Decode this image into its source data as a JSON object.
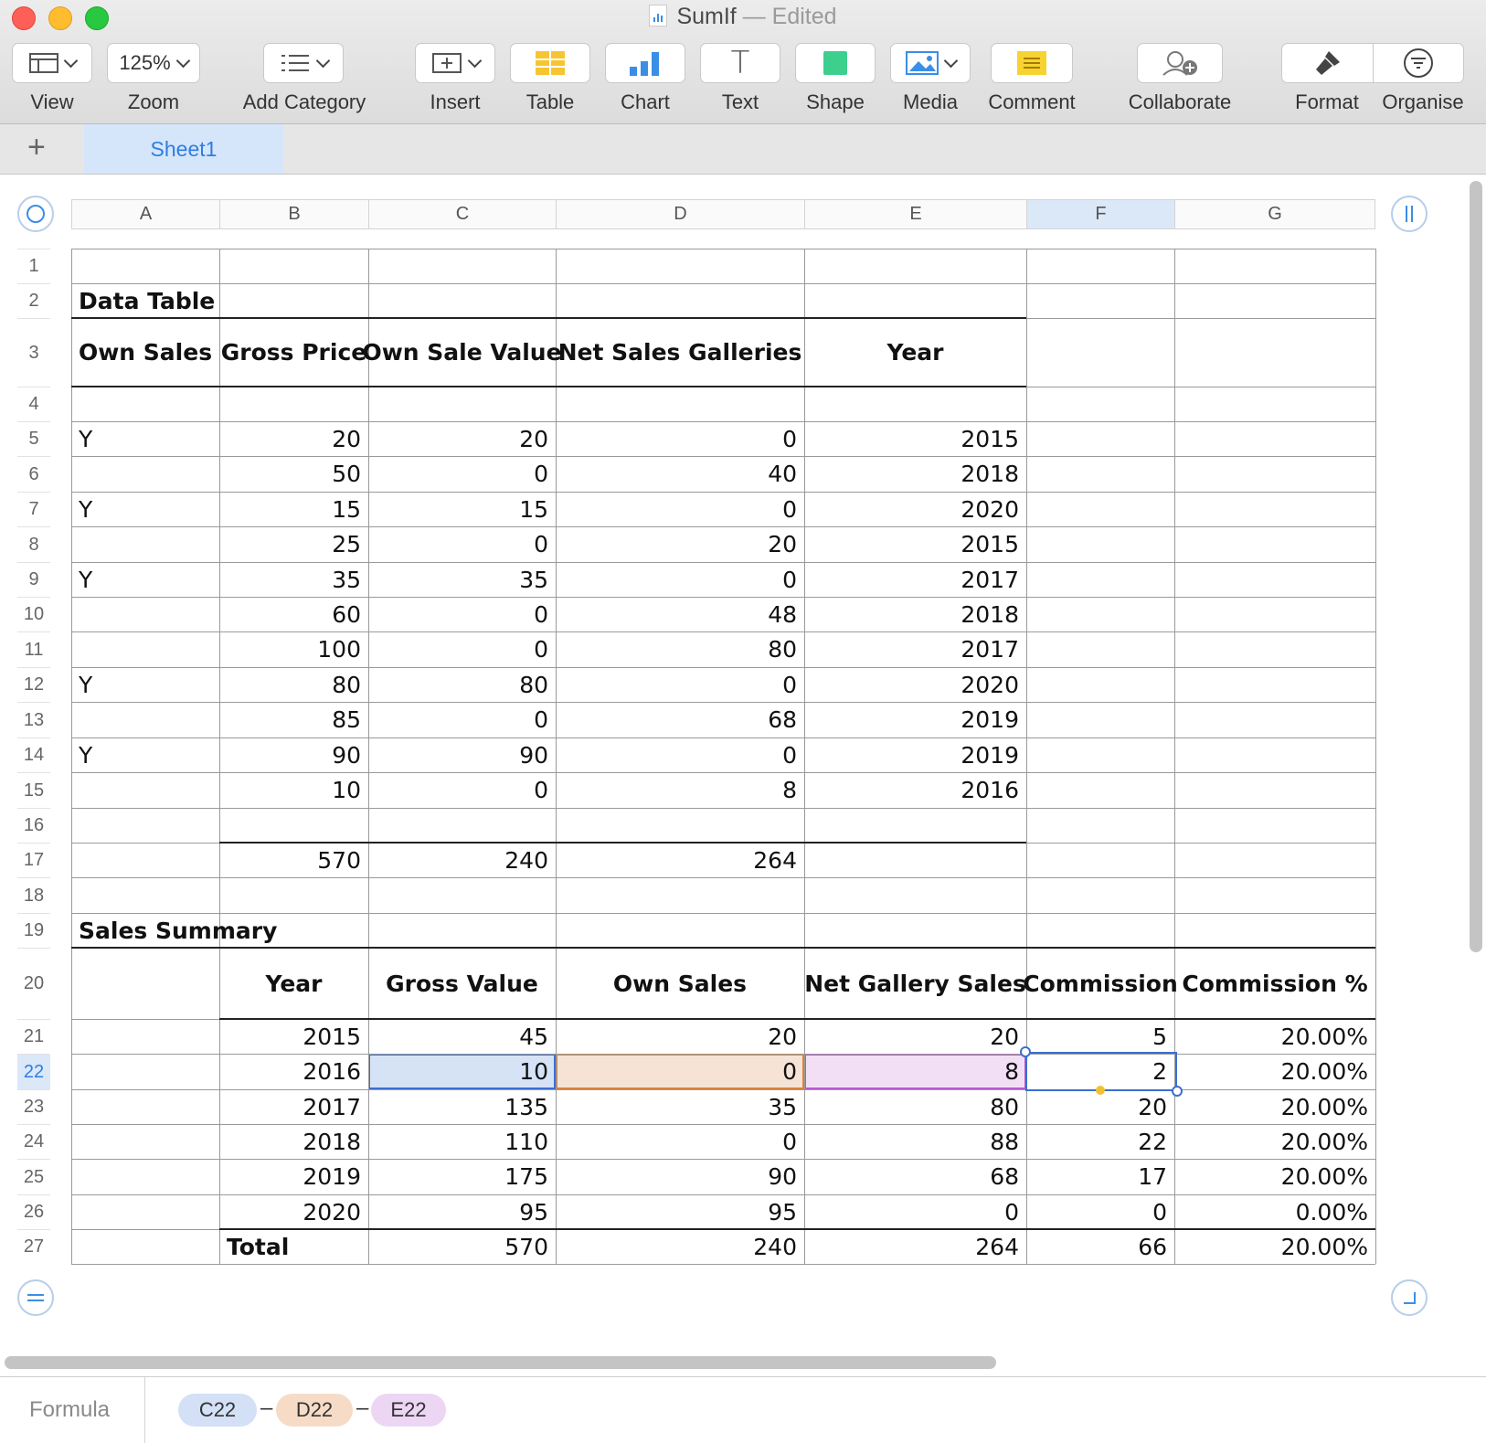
{
  "window": {
    "title": "SumIf",
    "edited_suffix": "— Edited"
  },
  "toolbar": {
    "view": "View",
    "zoom_value": "125%",
    "zoom": "Zoom",
    "add_category": "Add Category",
    "insert": "Insert",
    "table": "Table",
    "chart": "Chart",
    "text": "Text",
    "shape": "Shape",
    "media": "Media",
    "comment": "Comment",
    "collaborate": "Collaborate",
    "format": "Format",
    "organise": "Organise"
  },
  "tabs": {
    "add": "+",
    "sheet1": "Sheet1"
  },
  "columns": [
    "A",
    "B",
    "C",
    "D",
    "E",
    "F",
    "G"
  ],
  "rows": [
    "1",
    "2",
    "3",
    "4",
    "5",
    "6",
    "7",
    "8",
    "9",
    "10",
    "11",
    "12",
    "13",
    "14",
    "15",
    "16",
    "17",
    "18",
    "19",
    "20",
    "21",
    "22",
    "23",
    "24",
    "25",
    "26",
    "27"
  ],
  "data_table": {
    "title": "Data Table",
    "headers": [
      "Own Sales",
      "Gross Price",
      "Own Sale Value",
      "Net Sales Galleries",
      "Year"
    ],
    "rows": [
      [
        "Y",
        "20",
        "20",
        "0",
        "2015"
      ],
      [
        "",
        "50",
        "0",
        "40",
        "2018"
      ],
      [
        "Y",
        "15",
        "15",
        "0",
        "2020"
      ],
      [
        "",
        "25",
        "0",
        "20",
        "2015"
      ],
      [
        "Y",
        "35",
        "35",
        "0",
        "2017"
      ],
      [
        "",
        "60",
        "0",
        "48",
        "2018"
      ],
      [
        "",
        "100",
        "0",
        "80",
        "2017"
      ],
      [
        "Y",
        "80",
        "80",
        "0",
        "2020"
      ],
      [
        "",
        "85",
        "0",
        "68",
        "2019"
      ],
      [
        "Y",
        "90",
        "90",
        "0",
        "2019"
      ],
      [
        "",
        "10",
        "0",
        "8",
        "2016"
      ]
    ],
    "totals": [
      "570",
      "240",
      "264"
    ]
  },
  "sales_summary": {
    "title": "Sales Summary",
    "headers": [
      "Year",
      "Gross Value",
      "Own Sales",
      "Net Gallery Sales",
      "Commission",
      "Commission %"
    ],
    "rows": [
      [
        "2015",
        "45",
        "20",
        "20",
        "5",
        "20.00%"
      ],
      [
        "2016",
        "10",
        "0",
        "8",
        "2",
        "20.00%"
      ],
      [
        "2017",
        "135",
        "35",
        "80",
        "20",
        "20.00%"
      ],
      [
        "2018",
        "110",
        "0",
        "88",
        "22",
        "20.00%"
      ],
      [
        "2019",
        "175",
        "90",
        "68",
        "17",
        "20.00%"
      ],
      [
        "2020",
        "95",
        "95",
        "0",
        "0",
        "0.00%"
      ]
    ],
    "total": [
      "Total",
      "570",
      "240",
      "264",
      "66",
      "20.00%"
    ]
  },
  "formula_bar": {
    "label": "Formula",
    "tokens": [
      "C22",
      "D22",
      "E22"
    ],
    "operators": [
      "–",
      "–"
    ]
  },
  "colors": {
    "accent": "#2f7de1",
    "token_c": "#d3e0f6",
    "token_d": "#f6dcc7",
    "token_e": "#ecd6f4"
  }
}
